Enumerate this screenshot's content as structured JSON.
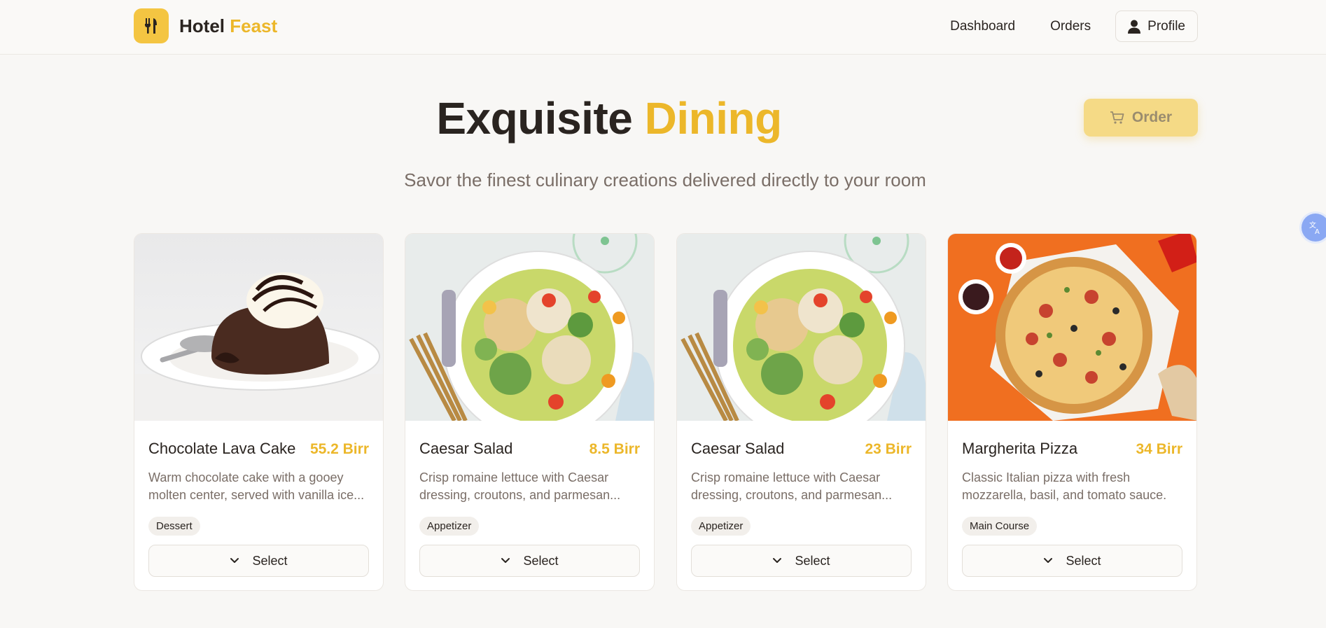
{
  "brand": {
    "name": "Hotel",
    "accent": "Feast",
    "logo_icon": "utensils-icon"
  },
  "nav": {
    "dashboard": "Dashboard",
    "orders": "Orders",
    "profile": "Profile"
  },
  "hero": {
    "title": "Exquisite",
    "title_accent": "Dining",
    "subtitle": "Savor the finest culinary creations delivered directly to your room"
  },
  "order_button": {
    "label": "Order",
    "icon": "cart-icon"
  },
  "colors": {
    "accent": "#ecb72a",
    "logo_bg": "#f4c542",
    "order_bg": "#f5da86"
  },
  "menu": [
    {
      "name": "Chocolate Lava Cake",
      "price": "55.2 Birr",
      "description": "Warm chocolate cake with a gooey molten center, served with vanilla ice...",
      "category": "Dessert",
      "select": "Select"
    },
    {
      "name": "Caesar Salad",
      "price": "8.5 Birr",
      "description": "Crisp romaine lettuce with Caesar dressing, croutons, and parmesan...",
      "category": "Appetizer",
      "select": "Select"
    },
    {
      "name": "Caesar Salad",
      "price": "23 Birr",
      "description": "Crisp romaine lettuce with Caesar dressing, croutons, and parmesan...",
      "category": "Appetizer",
      "select": "Select"
    },
    {
      "name": "Margherita Pizza",
      "price": "34 Birr",
      "description": "Classic Italian pizza with fresh mozzarella, basil, and tomato sauce.",
      "category": "Main Course",
      "select": "Select"
    }
  ]
}
